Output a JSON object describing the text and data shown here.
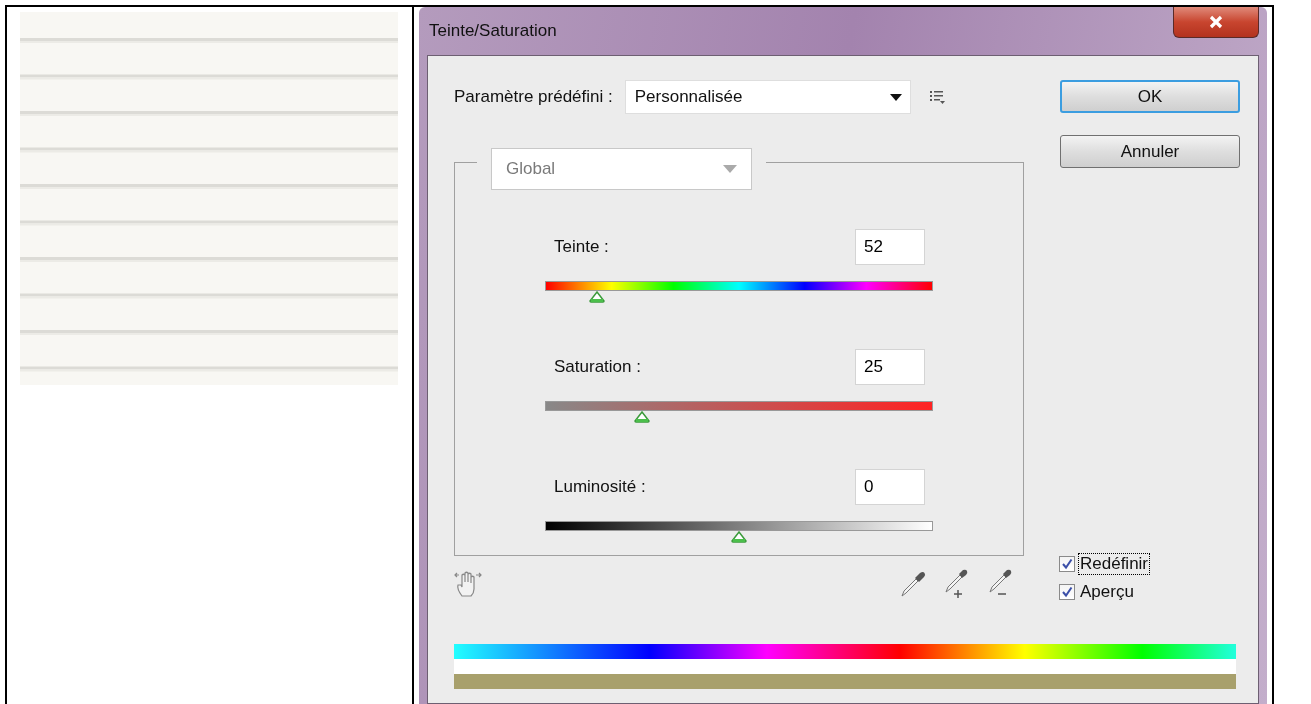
{
  "dialog": {
    "title": "Teinte/Saturation",
    "preset": {
      "label": "Paramètre prédéfini :",
      "value": "Personnalisée"
    },
    "buttons": [
      {
        "label": "OK",
        "default": true
      },
      {
        "label": "Annuler",
        "default": false
      }
    ],
    "channel": {
      "value": "Global",
      "disabled": true
    },
    "sliders": [
      {
        "kind": "hue",
        "label": "Teinte :",
        "value": "52",
        "level": 0.135
      },
      {
        "kind": "saturation",
        "label": "Saturation :",
        "value": "25",
        "level": 0.25
      },
      {
        "kind": "lightness",
        "label": "Luminosité :",
        "value": "0",
        "level": 0.5
      }
    ],
    "checkboxes": [
      {
        "label": "Redéfinir",
        "checked": true,
        "focused": true
      },
      {
        "label": "Aperçu",
        "checked": true,
        "focused": false
      }
    ]
  }
}
